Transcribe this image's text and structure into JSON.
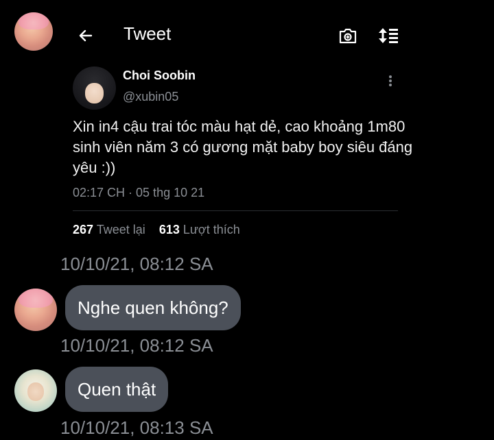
{
  "header": {
    "title": "Tweet",
    "back_icon": "arrow-left-icon",
    "camera_icon": "camera-add-icon",
    "sort_icon": "sort-list-icon"
  },
  "tweet": {
    "author_name": "Choi Soobin",
    "author_handle": "@xubin05",
    "text": "Xin in4 cậu trai tóc màu hạt dẻ, cao khoảng 1m80 sinh viên năm 3 có gương mặt baby boy siêu đáng yêu :))",
    "meta": "02:17 CH · 05 thg 10 21",
    "retweet_count": "267",
    "retweet_label": "Tweet lại",
    "like_count": "613",
    "like_label": "Lượt thích"
  },
  "messages": [
    {
      "timestamp": "10/10/21, 08:12 SA",
      "text": "Nghe quen không?"
    },
    {
      "timestamp": "10/10/21, 08:12 SA",
      "text": "Quen thật"
    },
    {
      "timestamp": "10/10/21, 08:13 SA"
    }
  ],
  "colors": {
    "background": "#000000",
    "secondary_text": "#8b8f95",
    "bubble": "#4b5059"
  }
}
